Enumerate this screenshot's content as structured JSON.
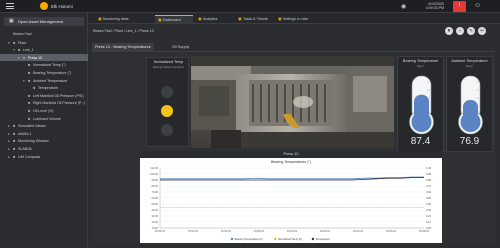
{
  "topbar": {
    "app_title": "Elk Hotomi",
    "date_line1": "4/10/2020",
    "date_line2": "4:09:33 PM",
    "alert_label": "!"
  },
  "sidebar": {
    "open_asset_label": "Open Asset Management",
    "items": [
      {
        "label": "Moses Fact",
        "indent": 0,
        "caret": "",
        "icon": ""
      },
      {
        "label": "Plant",
        "indent": 1,
        "caret": "▾",
        "icon": "■"
      },
      {
        "label": "Line_1",
        "indent": 2,
        "caret": "▾",
        "icon": "■"
      },
      {
        "label": "Press 10",
        "indent": 3,
        "caret": "▾",
        "icon": "■",
        "selected": true
      },
      {
        "label": "Normalized Temp (°)",
        "indent": 4,
        "caret": "",
        "icon": "■"
      },
      {
        "label": "Bearing Temperature (°)",
        "indent": 4,
        "caret": "",
        "icon": "■"
      },
      {
        "label": "Ambient Temperature",
        "indent": 4,
        "caret": "▾",
        "icon": "■"
      },
      {
        "label": "Temperature",
        "indent": 5,
        "caret": "",
        "icon": "■"
      },
      {
        "label": "Left Manifold Oil Pressure (PSI)",
        "indent": 4,
        "caret": "",
        "icon": "■"
      },
      {
        "label": "Right Manifold Oil Pressure (P...)",
        "indent": 4,
        "caret": "",
        "icon": "■"
      },
      {
        "label": "Oil Level (%)",
        "indent": 4,
        "caret": "",
        "icon": "■"
      },
      {
        "label": "Lubricant Volume",
        "indent": 4,
        "caret": "",
        "icon": "■"
      },
      {
        "label": "Simulated Values",
        "indent": 1,
        "caret": "▸",
        "icon": "■"
      },
      {
        "label": "eMAN-1",
        "indent": 1,
        "caret": "▸",
        "icon": "■"
      },
      {
        "label": "Monitoring Window",
        "indent": 1,
        "caret": "▸",
        "icon": "■"
      },
      {
        "label": "SLABS6",
        "indent": 1,
        "caret": "▸",
        "icon": "■"
      },
      {
        "label": "LIM Compass",
        "indent": 1,
        "caret": "▸",
        "icon": "■"
      }
    ]
  },
  "tabs": [
    {
      "label": "Monitoring table",
      "icon": "▣"
    },
    {
      "label": "Dashboard",
      "icon": "▣",
      "active": true
    },
    {
      "label": "Analytics",
      "icon": "▣"
    },
    {
      "label": "Tasks & Tickets",
      "icon": "▣"
    },
    {
      "label": "Settings & roles",
      "icon": "▣"
    }
  ],
  "breadcrumb": "Moses Fact / Plant / Line_1 / Press 10",
  "tool_icons": [
    "filter-icon",
    "add-icon",
    "edit-icon",
    "link-icon"
  ],
  "subtabs": [
    {
      "label": "Press 10 - Bearing Temperatures",
      "active": true
    },
    {
      "label": "Oil Supply"
    }
  ],
  "normalized_panel": {
    "title": "Normalized Temp",
    "subtitle": "Bearing relative to Ambient",
    "lights": [
      "off",
      "on",
      "off"
    ]
  },
  "gauges": [
    {
      "title": "Bearing Temperature",
      "unit": "Deg F",
      "value": "87.4",
      "fill": 0.62,
      "color": "#5b84c4"
    },
    {
      "title": "Ambient Temperature",
      "unit": "Deg F",
      "value": "76.9",
      "fill": 0.5,
      "color": "#5b84c4"
    }
  ],
  "chart_panel": {
    "header": "Press 10"
  },
  "chart_data": {
    "type": "line",
    "title": "Bearing Temperatures (°)",
    "x": [
      "15:52:01",
      "15:54:01",
      "15:56:01",
      "15:58:01",
      "16:00:01",
      "16:02:01",
      "16:04:01",
      "16:06:01",
      "16:08:01"
    ],
    "y_left_ticks": [
      "110.00",
      "100.00",
      "90.00",
      "80.00",
      "70.00",
      "60.00",
      "50.00",
      "40.00",
      "30.00",
      "20.00",
      "10.00"
    ],
    "y_right_ticks": [
      "1.00",
      "0.90",
      "0.80",
      "0.70",
      "0.60",
      "0.50",
      "0.40",
      "0.30",
      "0.20",
      "0.10",
      "0.00"
    ],
    "ylim": [
      10,
      110
    ],
    "series": [
      {
        "name": "Bearing Temperature (F)",
        "color": "#5b84c4",
        "values": [
          92,
          92,
          92,
          92,
          92,
          92,
          92,
          92,
          93,
          92,
          92,
          92,
          92,
          92,
          92,
          92,
          92,
          93,
          93,
          94,
          94,
          95,
          95
        ]
      },
      {
        "name": "Normalized Temp (F)",
        "color": "#f5b400",
        "values": [
          44,
          44,
          44,
          44,
          44,
          44,
          44,
          44,
          44,
          44,
          44,
          44,
          44,
          44,
          44,
          44,
          44,
          44,
          44,
          44,
          44,
          44,
          44
        ]
      },
      {
        "name": "Temperature",
        "color": "#333333",
        "values": [
          90,
          90,
          90,
          90,
          90,
          90,
          90,
          90,
          90,
          90,
          90,
          90,
          90,
          90,
          90,
          90,
          90,
          91,
          92,
          93,
          93,
          94,
          94
        ]
      }
    ],
    "legend_position": "bottom"
  },
  "colors": {
    "accent": "#f2a900",
    "alert": "#e53935",
    "selected": "#5a6068"
  }
}
